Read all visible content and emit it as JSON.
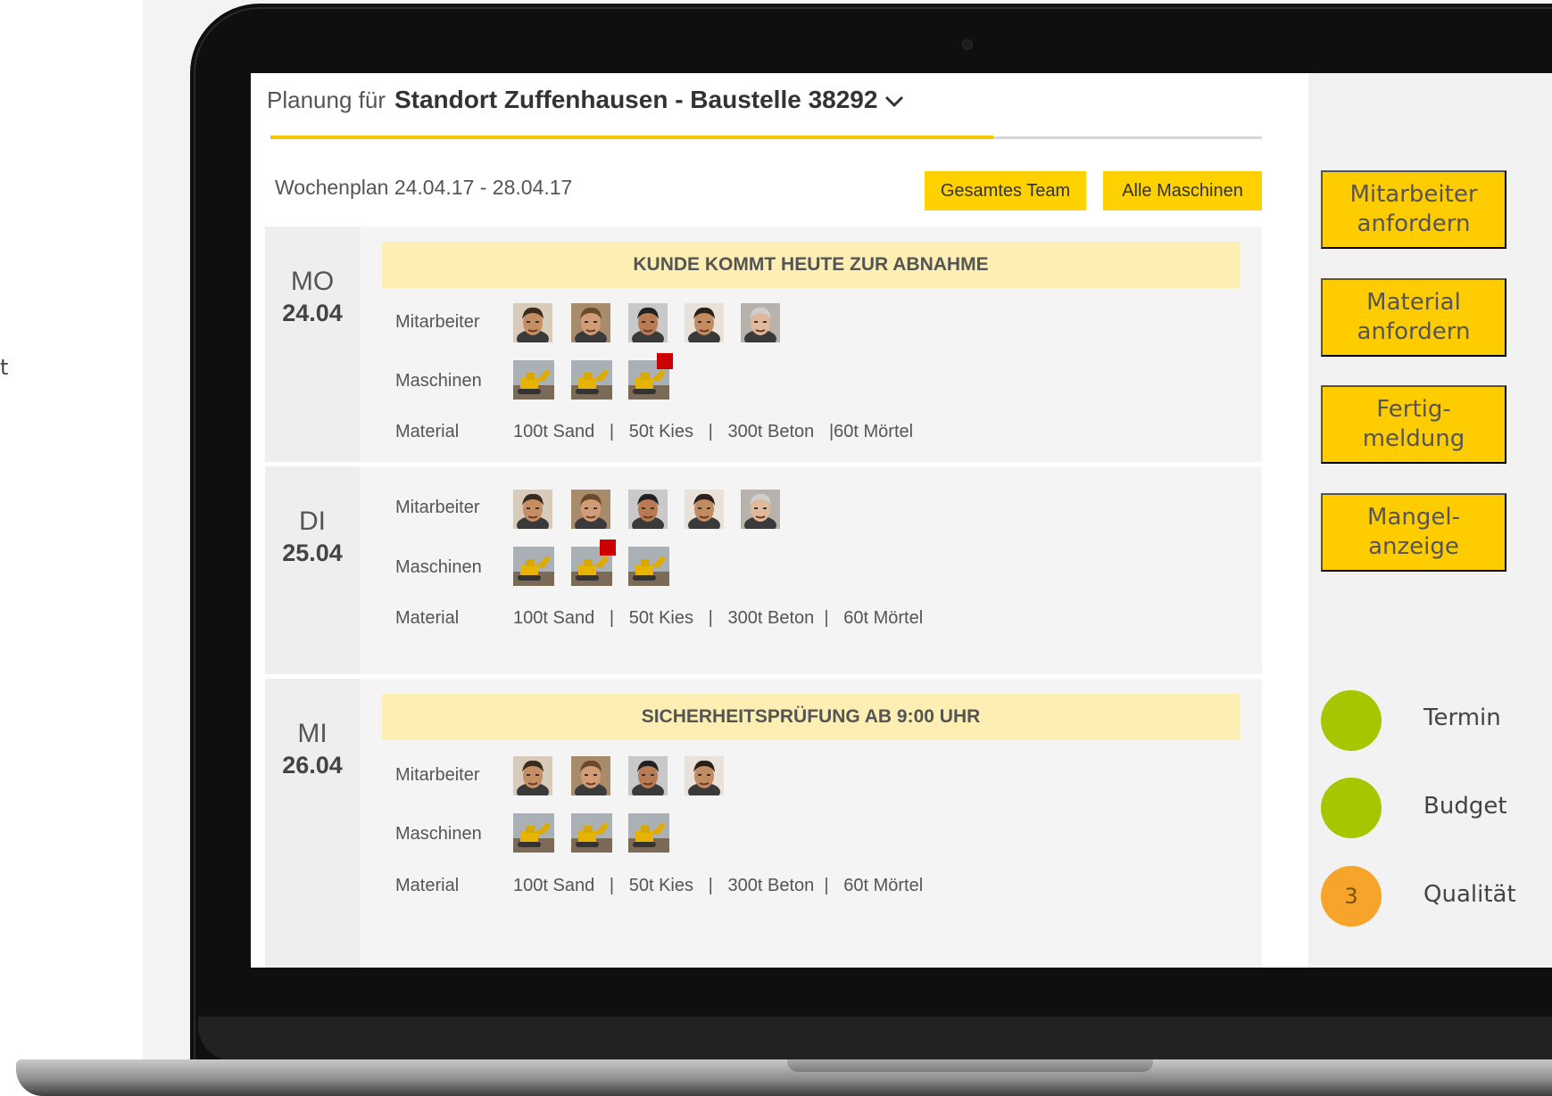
{
  "cut_text": "t",
  "header": {
    "prefix": "Planung für",
    "site": "Standort Zuffenhausen - Baustelle 38292"
  },
  "week": {
    "label": "Wochenplan 24.04.17 - 28.04.17"
  },
  "buttons": {
    "team": "Gesamtes Team",
    "machines": "Alle Maschinen"
  },
  "labels": {
    "staff": "Mitarbeiter",
    "machines": "Maschinen",
    "material": "Material"
  },
  "days": [
    {
      "name": "MO",
      "date": "24.04",
      "banner": "KUNDE KOMMT HEUTE ZUR ABNAHME",
      "material": "100t Sand   |   50t Kies   |   300t Beton   |60t Mörtel",
      "staff_count": 5,
      "machine_alerts": [
        false,
        false,
        true
      ]
    },
    {
      "name": "DI",
      "date": "25.04",
      "banner": "",
      "material": "100t Sand   |   50t Kies   |   300t Beton  |   60t Mörtel",
      "staff_count": 5,
      "machine_alerts": [
        false,
        true,
        false
      ]
    },
    {
      "name": "MI",
      "date": "26.04",
      "banner": "SICHERHEITSPRÜFUNG AB 9:00 UHR",
      "material": "100t Sand   |   50t Kies   |   300t Beton  |   60t Mörtel",
      "staff_count": 4,
      "machine_alerts": [
        false,
        false,
        false
      ]
    }
  ],
  "side_actions": [
    {
      "line1": "Mitarbeiter",
      "line2": "anfordern"
    },
    {
      "line1": "Material",
      "line2": "anfordern"
    },
    {
      "line1": "Fertig-",
      "line2": "meldung"
    },
    {
      "line1": "Mangel-",
      "line2": "anzeige"
    }
  ],
  "status": [
    {
      "label": "Termin",
      "value": "",
      "color": "#a6c600"
    },
    {
      "label": "Budget",
      "value": "",
      "color": "#a6c600"
    },
    {
      "label": "Qualität",
      "value": "3",
      "color": "#f7a52a"
    }
  ],
  "colors": {
    "accent": "#ffd100",
    "banner": "#fdeeb3",
    "alert": "#cc0000"
  }
}
